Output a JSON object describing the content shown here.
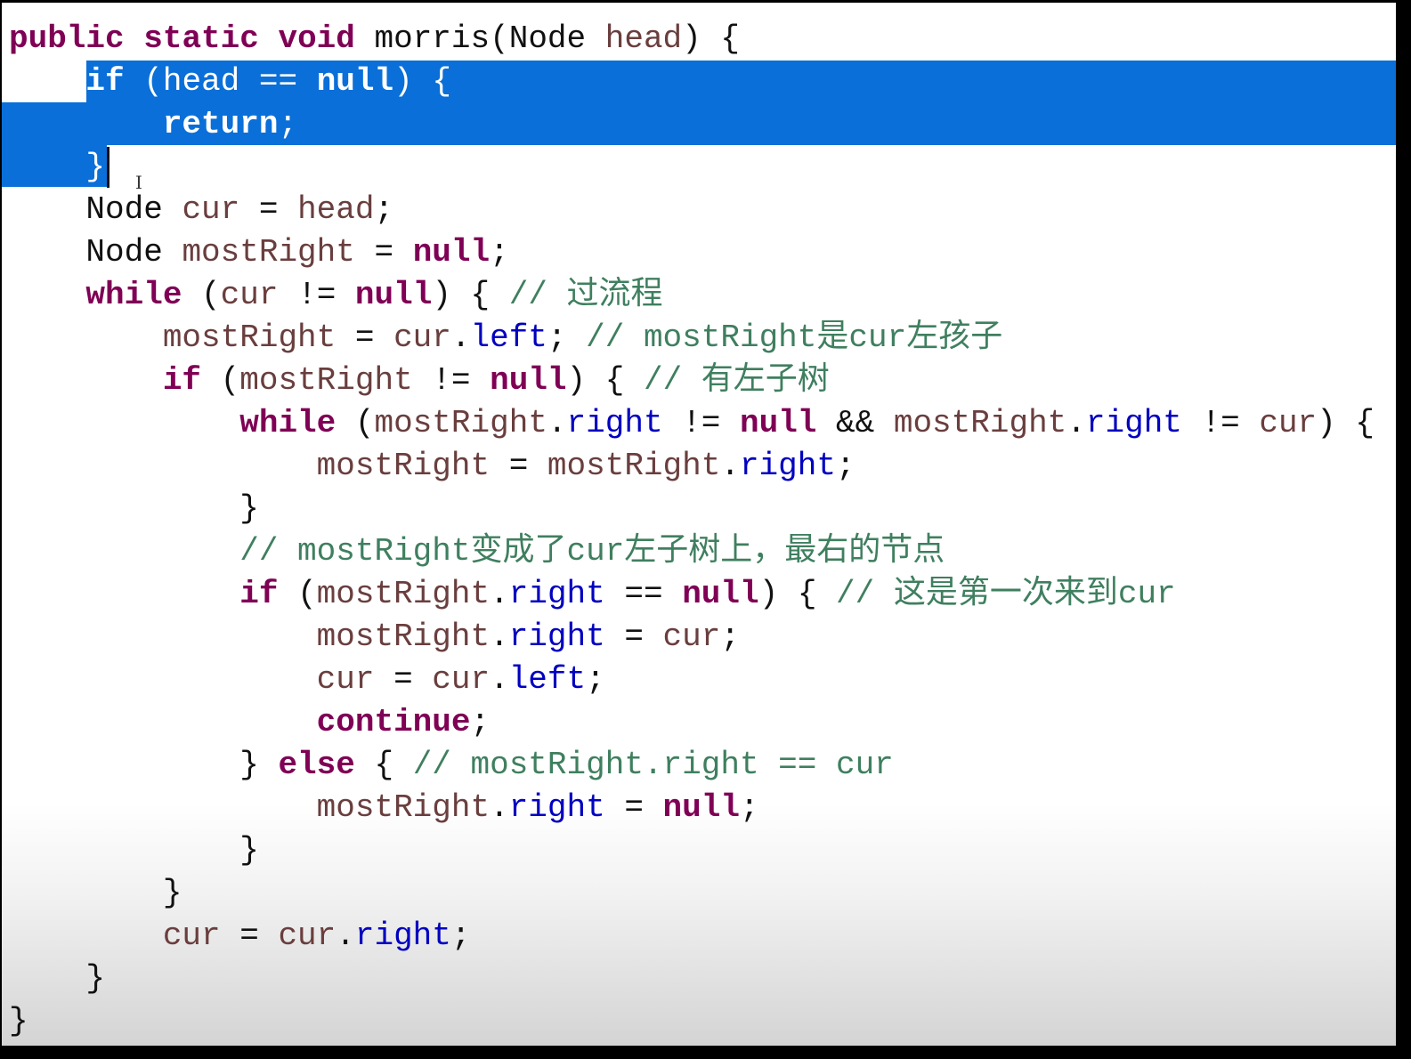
{
  "editor": {
    "colors": {
      "keyword": "#7f0055",
      "local_variable": "#6a3e3e",
      "field": "#0000c0",
      "comment": "#3f7f5f",
      "selection": "#0a6fd8"
    },
    "selected_lines": [
      2,
      3,
      4
    ],
    "caret_line": 4,
    "lines": [
      [
        [
          "kw",
          "public"
        ],
        [
          "plain",
          " "
        ],
        [
          "kw",
          "static"
        ],
        [
          "plain",
          " "
        ],
        [
          "kw",
          "void"
        ],
        [
          "plain",
          " morris(Node "
        ],
        [
          "var",
          "head"
        ],
        [
          "plain",
          ") {"
        ]
      ],
      [
        [
          "plain",
          "    "
        ],
        [
          "kw",
          "if"
        ],
        [
          "plain",
          " ("
        ],
        [
          "var",
          "head"
        ],
        [
          "plain",
          " == "
        ],
        [
          "kw",
          "null"
        ],
        [
          "plain",
          ") {"
        ]
      ],
      [
        [
          "plain",
          "        "
        ],
        [
          "kw",
          "return"
        ],
        [
          "plain",
          ";"
        ]
      ],
      [
        [
          "plain",
          "    }"
        ]
      ],
      [
        [
          "plain",
          "    Node "
        ],
        [
          "var",
          "cur"
        ],
        [
          "plain",
          " = "
        ],
        [
          "var",
          "head"
        ],
        [
          "plain",
          ";"
        ]
      ],
      [
        [
          "plain",
          "    Node "
        ],
        [
          "var",
          "mostRight"
        ],
        [
          "plain",
          " = "
        ],
        [
          "kw",
          "null"
        ],
        [
          "plain",
          ";"
        ]
      ],
      [
        [
          "plain",
          "    "
        ],
        [
          "kw",
          "while"
        ],
        [
          "plain",
          " ("
        ],
        [
          "var",
          "cur"
        ],
        [
          "plain",
          " != "
        ],
        [
          "kw",
          "null"
        ],
        [
          "plain",
          ") { "
        ],
        [
          "cmt",
          "// 过流程"
        ]
      ],
      [
        [
          "plain",
          "        "
        ],
        [
          "var",
          "mostRight"
        ],
        [
          "plain",
          " = "
        ],
        [
          "var",
          "cur"
        ],
        [
          "plain",
          "."
        ],
        [
          "field",
          "left"
        ],
        [
          "plain",
          "; "
        ],
        [
          "cmt",
          "// mostRight是cur左孩子"
        ]
      ],
      [
        [
          "plain",
          "        "
        ],
        [
          "kw",
          "if"
        ],
        [
          "plain",
          " ("
        ],
        [
          "var",
          "mostRight"
        ],
        [
          "plain",
          " != "
        ],
        [
          "kw",
          "null"
        ],
        [
          "plain",
          ") { "
        ],
        [
          "cmt",
          "// 有左子树"
        ]
      ],
      [
        [
          "plain",
          "            "
        ],
        [
          "kw",
          "while"
        ],
        [
          "plain",
          " ("
        ],
        [
          "var",
          "mostRight"
        ],
        [
          "plain",
          "."
        ],
        [
          "field",
          "right"
        ],
        [
          "plain",
          " != "
        ],
        [
          "kw",
          "null"
        ],
        [
          "plain",
          " && "
        ],
        [
          "var",
          "mostRight"
        ],
        [
          "plain",
          "."
        ],
        [
          "field",
          "right"
        ],
        [
          "plain",
          " != "
        ],
        [
          "var",
          "cur"
        ],
        [
          "plain",
          ") {"
        ]
      ],
      [
        [
          "plain",
          "                "
        ],
        [
          "var",
          "mostRight"
        ],
        [
          "plain",
          " = "
        ],
        [
          "var",
          "mostRight"
        ],
        [
          "plain",
          "."
        ],
        [
          "field",
          "right"
        ],
        [
          "plain",
          ";"
        ]
      ],
      [
        [
          "plain",
          "            }"
        ]
      ],
      [
        [
          "plain",
          "            "
        ],
        [
          "cmt",
          "// mostRight变成了cur左子树上，最右的节点"
        ]
      ],
      [
        [
          "plain",
          "            "
        ],
        [
          "kw",
          "if"
        ],
        [
          "plain",
          " ("
        ],
        [
          "var",
          "mostRight"
        ],
        [
          "plain",
          "."
        ],
        [
          "field",
          "right"
        ],
        [
          "plain",
          " == "
        ],
        [
          "kw",
          "null"
        ],
        [
          "plain",
          ") { "
        ],
        [
          "cmt",
          "// 这是第一次来到cur"
        ]
      ],
      [
        [
          "plain",
          "                "
        ],
        [
          "var",
          "mostRight"
        ],
        [
          "plain",
          "."
        ],
        [
          "field",
          "right"
        ],
        [
          "plain",
          " = "
        ],
        [
          "var",
          "cur"
        ],
        [
          "plain",
          ";"
        ]
      ],
      [
        [
          "plain",
          "                "
        ],
        [
          "var",
          "cur"
        ],
        [
          "plain",
          " = "
        ],
        [
          "var",
          "cur"
        ],
        [
          "plain",
          "."
        ],
        [
          "field",
          "left"
        ],
        [
          "plain",
          ";"
        ]
      ],
      [
        [
          "plain",
          "                "
        ],
        [
          "kw",
          "continue"
        ],
        [
          "plain",
          ";"
        ]
      ],
      [
        [
          "plain",
          "            } "
        ],
        [
          "kw",
          "else"
        ],
        [
          "plain",
          " { "
        ],
        [
          "cmt",
          "// mostRight.right == cur"
        ]
      ],
      [
        [
          "plain",
          "                "
        ],
        [
          "var",
          "mostRight"
        ],
        [
          "plain",
          "."
        ],
        [
          "field",
          "right"
        ],
        [
          "plain",
          " = "
        ],
        [
          "kw",
          "null"
        ],
        [
          "plain",
          ";"
        ]
      ],
      [
        [
          "plain",
          "            }"
        ]
      ],
      [
        [
          "plain",
          "        }"
        ]
      ],
      [
        [
          "plain",
          "        "
        ],
        [
          "var",
          "cur"
        ],
        [
          "plain",
          " = "
        ],
        [
          "var",
          "cur"
        ],
        [
          "plain",
          "."
        ],
        [
          "field",
          "right"
        ],
        [
          "plain",
          ";"
        ]
      ],
      [
        [
          "plain",
          "    }"
        ]
      ],
      [
        [
          "plain",
          "}"
        ]
      ]
    ]
  }
}
